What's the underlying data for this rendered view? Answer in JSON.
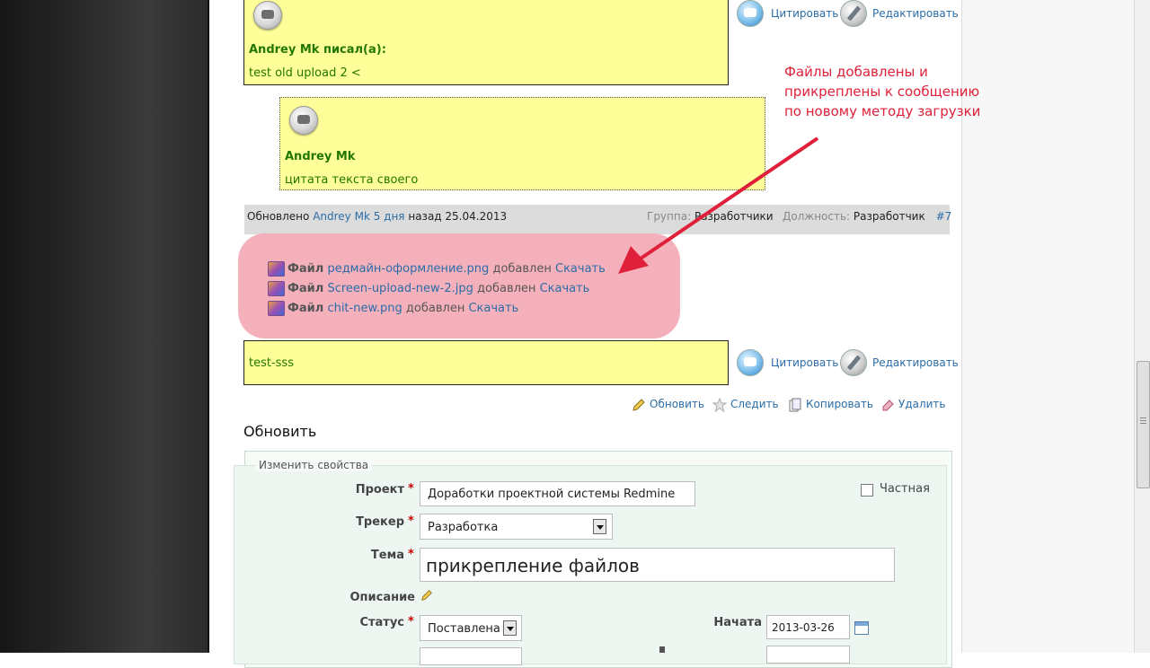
{
  "post1": {
    "author_line": "Andrey Mk писал(а):",
    "text": "test old upload 2 <"
  },
  "nested_quote": {
    "author": "Andrey Mk",
    "text": "цитата текста своего"
  },
  "actions": {
    "quote": "Цитировать",
    "edit": "Редактировать"
  },
  "meta": {
    "updated_label": "Обновлено",
    "author": "Andrey Mk",
    "ago": "5 дня",
    "ago_suffix": "назад 25.04.2013",
    "group_label": "Группа:",
    "group_value": "Разработчики",
    "role_label": "Должность:",
    "role_value": "Разработчик",
    "number": "#7"
  },
  "annotation": [
    "Файлы добавлены и",
    "прикреплены к сообщению",
    "по новому методу загрузки"
  ],
  "files": [
    {
      "prefix": "Файл",
      "name": "редмайн-оформление.png",
      "added": "добавлен",
      "download": "Скачать"
    },
    {
      "prefix": "Файл",
      "name": "Screen-upload-new-2.jpg",
      "added": "добавлен",
      "download": "Скачать"
    },
    {
      "prefix": "Файл",
      "name": "chit-new.png",
      "added": "добавлен",
      "download": "Скачать"
    }
  ],
  "post2": {
    "text": "test-sss"
  },
  "contextual": {
    "update": "Обновить",
    "watch": "Следить",
    "copy": "Копировать",
    "delete": "Удалить"
  },
  "update_section": {
    "title": "Обновить",
    "legend": "Изменить свойства",
    "project_label": "Проект",
    "project_value": "Доработки проектной системы Redmine",
    "private_label": "Частная",
    "tracker_label": "Трекер",
    "tracker_value": "Разработка",
    "subject_label": "Тема",
    "subject_value": "прикрепление файлов",
    "description_label": "Описание",
    "status_label": "Статус",
    "status_value": "Поставлена",
    "start_label": "Начата",
    "start_value": "2013-03-26"
  }
}
